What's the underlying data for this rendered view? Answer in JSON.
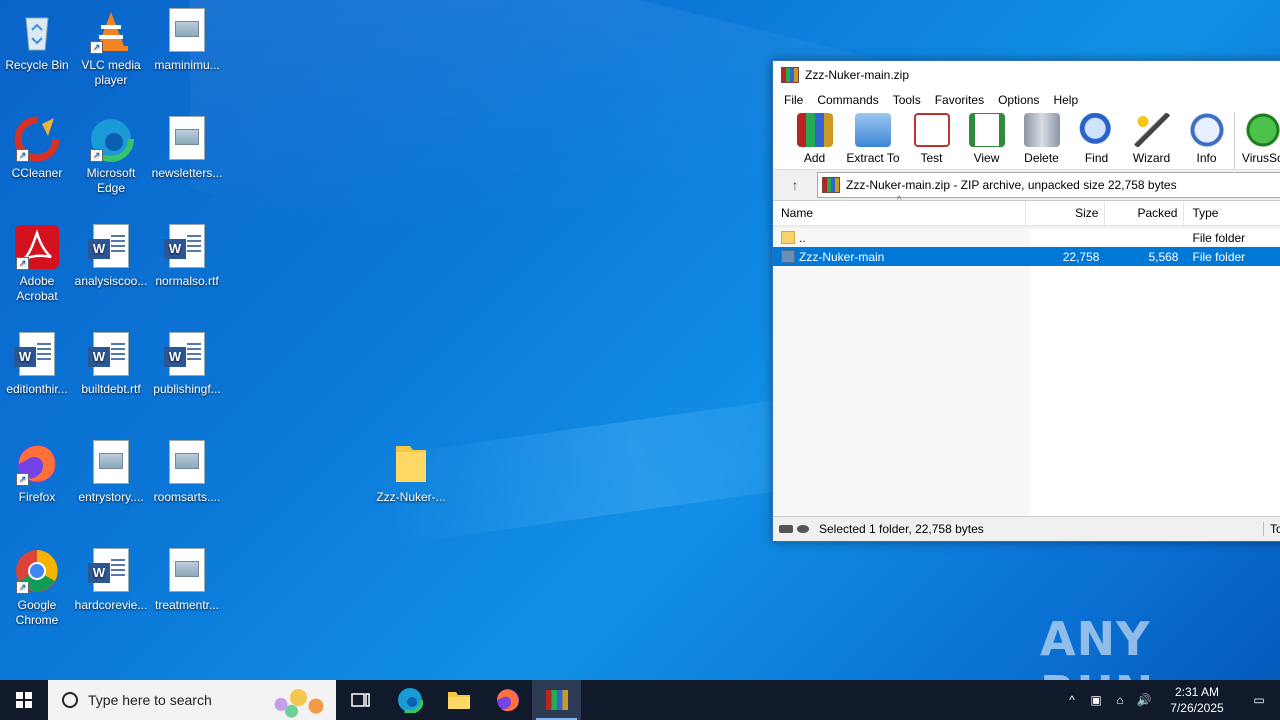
{
  "desktop": {
    "icons": [
      {
        "label": "Recycle Bin"
      },
      {
        "label": "VLC media player"
      },
      {
        "label": "maminimu..."
      },
      {
        "label": "CCleaner"
      },
      {
        "label": "Microsoft Edge"
      },
      {
        "label": "newsletters..."
      },
      {
        "label": "Adobe Acrobat"
      },
      {
        "label": "analysiscoo..."
      },
      {
        "label": "normalso.rtf"
      },
      {
        "label": "editionthir..."
      },
      {
        "label": "builtdebt.rtf"
      },
      {
        "label": "publishingf..."
      },
      {
        "label": "Firefox"
      },
      {
        "label": "entrystory...."
      },
      {
        "label": "roomsarts...."
      },
      {
        "label": "Google Chrome"
      },
      {
        "label": "hardcorevie..."
      },
      {
        "label": "treatmentr..."
      },
      {
        "label": "Zzz-Nuker-..."
      }
    ]
  },
  "winrar": {
    "title": "Zzz-Nuker-main.zip",
    "menu": [
      "File",
      "Commands",
      "Tools",
      "Favorites",
      "Options",
      "Help"
    ],
    "toolbar": [
      "Add",
      "Extract To",
      "Test",
      "View",
      "Delete",
      "Find",
      "Wizard",
      "Info",
      "VirusSc"
    ],
    "path": "Zzz-Nuker-main.zip - ZIP archive, unpacked size 22,758 bytes",
    "columns": [
      "Name",
      "Size",
      "Packed",
      "Type"
    ],
    "rows": [
      {
        "name": "..",
        "size": "",
        "packed": "",
        "type": "File folder"
      },
      {
        "name": "Zzz-Nuker-main",
        "size": "22,758",
        "packed": "5,568",
        "type": "File folder"
      }
    ],
    "status": "Selected 1 folder, 22,758 bytes",
    "status_right": "To"
  },
  "taskbar": {
    "search_placeholder": "Type here to search",
    "time": "2:31 AM",
    "date": "7/26/2025"
  },
  "watermark": "ANY RUN"
}
